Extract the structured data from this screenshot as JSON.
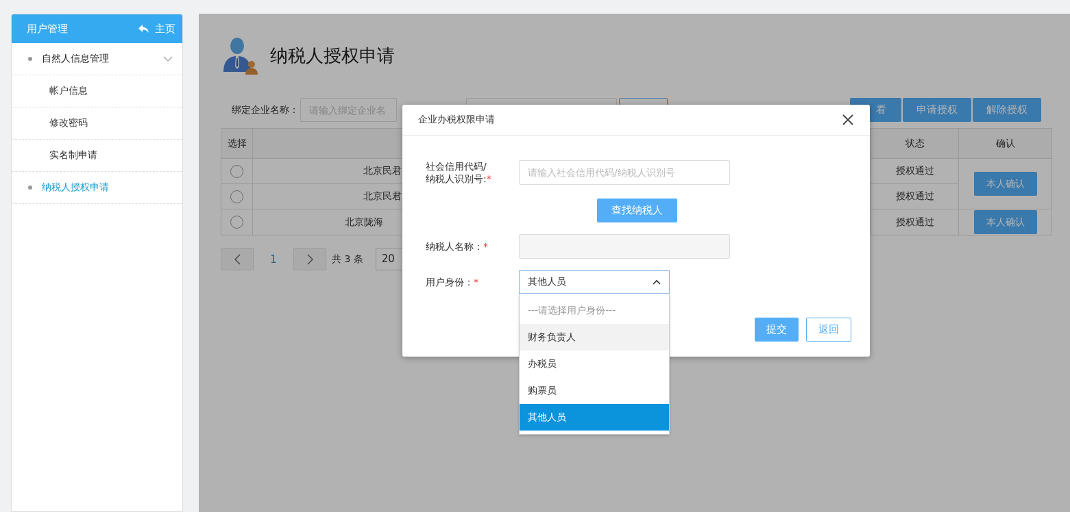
{
  "sidebar": {
    "title": "用户管理",
    "home_link": "主页",
    "items": [
      {
        "label": "自然人信息管理",
        "selected": false,
        "expanded": true,
        "children": [
          {
            "label": "帐户信息",
            "selected": false
          },
          {
            "label": "修改密码",
            "selected": false
          },
          {
            "label": "实名制申请",
            "selected": false
          }
        ]
      },
      {
        "label": "纳税人授权申请",
        "selected": true
      }
    ]
  },
  "page": {
    "title": "纳税人授权申请"
  },
  "filter": {
    "label": "绑定企业名称：",
    "placeholder": "请输入绑定企业名"
  },
  "actions": [
    "看",
    "申请授权",
    "解除授权"
  ],
  "table": {
    "columns": [
      {
        "kind": "select",
        "label": "选择"
      },
      {
        "kind": "name"
      },
      {
        "kind": "status",
        "label": "状态"
      },
      {
        "kind": "confirm",
        "label": "确认"
      }
    ],
    "rows": [
      {
        "selected": false,
        "name": "北京民君",
        "status": "授权通过",
        "confirm": "本人确认"
      },
      {
        "selected": false,
        "name": "北京民君",
        "status": "授权通过"
      },
      {
        "selected": false,
        "name": "北京陇海",
        "status": "授权通过",
        "confirm": "本人确认"
      }
    ]
  },
  "pagination": {
    "current": "1",
    "total": "共 3 条",
    "page_size": "20"
  },
  "dialog": {
    "title": "企业办税权限申请",
    "fields": [
      {
        "kind": "text",
        "label": "社会信用代码/\n纳税人识别号:",
        "required": "*",
        "placeholder": "请输入社会信用代码/纳税人识别号"
      },
      {
        "kind": "button",
        "label": "查找纳税人"
      },
      {
        "kind": "readonly",
        "label": "纳税人名称：",
        "required": "*"
      },
      {
        "kind": "select",
        "label": "用户身份：",
        "required": "*",
        "value": "其他人员",
        "expanded": true,
        "options": [
          {
            "kind": "placeholder",
            "label": "---请选择用户身份---",
            "hovered": false,
            "selected": false
          },
          {
            "kind": "option",
            "label": "财务负责人",
            "hovered": true,
            "selected": false
          },
          {
            "kind": "option",
            "label": "办税员",
            "hovered": false,
            "selected": false
          },
          {
            "kind": "option",
            "label": "购票员",
            "hovered": false,
            "selected": false
          },
          {
            "kind": "option",
            "label": "其他人员",
            "hovered": false,
            "selected": true
          }
        ]
      }
    ],
    "buttons": [
      {
        "kind": "primary",
        "label": "提交"
      },
      {
        "kind": "outline",
        "label": "返回"
      }
    ]
  }
}
